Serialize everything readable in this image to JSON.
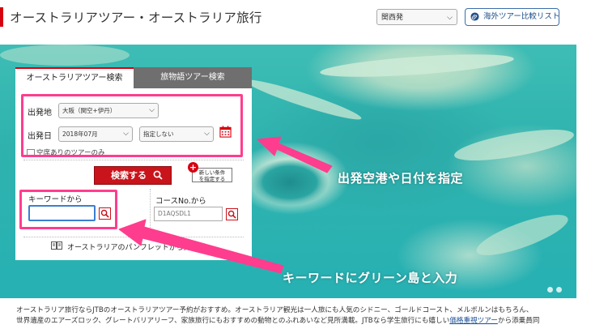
{
  "header": {
    "title": "オーストラリアツアー・オーストラリア旅行",
    "departure_select": "関西発",
    "compare_button": "海外ツアー比較リスト"
  },
  "search_panel": {
    "tabs": [
      {
        "label": "オーストラリアツアー検索",
        "active": true
      },
      {
        "label": "旅物語ツアー検索",
        "active": false
      }
    ],
    "departure_label": "出発地",
    "departure_value": "大阪（関空+伊丹）",
    "date_label": "出発日",
    "month_value": "2018年07月",
    "day_value": "指定しない",
    "vacancy_checkbox": "空席ありのツアーのみ",
    "search_button": "検索する",
    "new_condition_line1": "新しい条件",
    "new_condition_line2": "を指定する",
    "keyword_label": "キーワードから",
    "keyword_value": "",
    "course_label": "コースNo.から",
    "course_placeholder": "D1AQSDL1",
    "pamphlet_link": "オーストラリアのパンフレットから探す"
  },
  "annotations": {
    "airport_date": "出発空港や日付を指定",
    "keyword": "キーワードにグリーン島と入力"
  },
  "colors": {
    "accent_red": "#d7000f",
    "annotation_pink": "#ff3d8e",
    "link_blue": "#1a4f96"
  },
  "description": {
    "line1": "オーストラリア旅行ならJTBのオーストラリアツアー予約がおすすめ。オーストラリア観光は一人旅にも人気のシドニー、ゴールドコースト、メルボルンはもちろん、",
    "line2_before": "世界遺産のエアーズロック、グレートバリアリーフ、家族旅行にもおすすめの動物とのふれあいなど見所満載。JTBなら学生旅行にも嬉しい",
    "line2_link": "価格重視ツアー",
    "line2_after": "から添乗員同"
  }
}
